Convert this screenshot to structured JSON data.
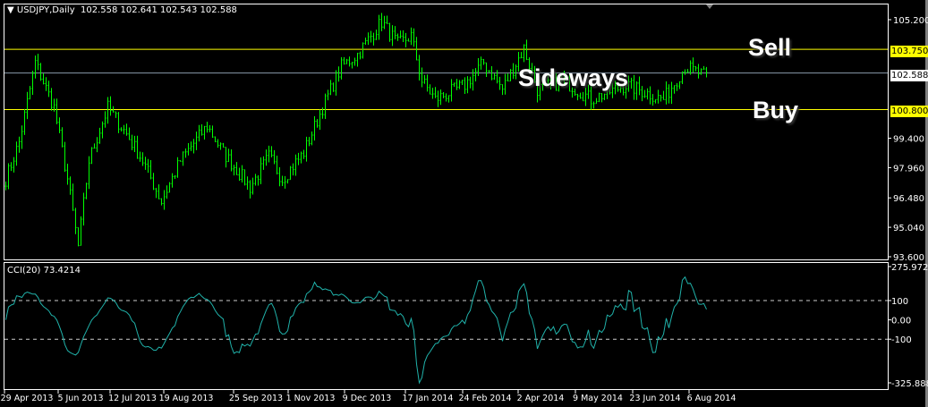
{
  "header": {
    "symbol": "USDJPY,Daily",
    "ohlc": "102.558 102.641 102.543 102.588"
  },
  "annotations": {
    "sell": "Sell",
    "sideways": "Sideways",
    "buy": "Buy"
  },
  "price_tags": {
    "sell_level": "103.750",
    "current": "102.588",
    "buy_level": "100.800"
  },
  "colors": {
    "bars": "#00ff00",
    "cci": "#20b2aa",
    "level": "#ffff00",
    "bid": "#8899aa"
  },
  "chart_data": [
    {
      "type": "ohlc",
      "title": "USDJPY,Daily",
      "yticks": [
        "105.200",
        "103.750",
        "102.588",
        "100.800",
        "99.400",
        "97.960",
        "96.480",
        "95.040",
        "93.600"
      ],
      "ylim": [
        93.6,
        105.2
      ],
      "hlines": [
        103.75,
        102.588,
        100.8
      ],
      "xticks": [
        "29 Apr 2013",
        "5 Jun 2013",
        "12 Jul 2013",
        "19 Aug 2013",
        "25 Sep 2013",
        "1 Nov 2013",
        "9 Dec 2013",
        "17 Jan 2014",
        "24 Feb 2014",
        "2 Apr 2014",
        "9 May 2014",
        "23 Jun 2014",
        "6 Aug 2014"
      ],
      "close_waypoints": [
        [
          0,
          97.4
        ],
        [
          5,
          99.2
        ],
        [
          11,
          103.1
        ],
        [
          18,
          100.9
        ],
        [
          23,
          97.4
        ],
        [
          27,
          94.1
        ],
        [
          31,
          98.3
        ],
        [
          38,
          100.9
        ],
        [
          45,
          99.6
        ],
        [
          51,
          98.3
        ],
        [
          58,
          96.3
        ],
        [
          65,
          98.3
        ],
        [
          75,
          100.0
        ],
        [
          81,
          98.7
        ],
        [
          91,
          97.0
        ],
        [
          98,
          98.5
        ],
        [
          103,
          97.4
        ],
        [
          111,
          98.7
        ],
        [
          118,
          100.9
        ],
        [
          125,
          102.9
        ],
        [
          131,
          103.5
        ],
        [
          140,
          105.1
        ],
        [
          146,
          104.0
        ],
        [
          151,
          104.4
        ],
        [
          155,
          102.2
        ],
        [
          160,
          101.3
        ],
        [
          171,
          102.0
        ],
        [
          178,
          103.1
        ],
        [
          185,
          101.8
        ],
        [
          193,
          103.8
        ],
        [
          198,
          101.8
        ],
        [
          208,
          102.2
        ],
        [
          218,
          101.3
        ],
        [
          231,
          102.0
        ],
        [
          245,
          101.3
        ],
        [
          253,
          102.9
        ],
        [
          261,
          102.4
        ]
      ]
    },
    {
      "type": "line",
      "title": "CCI(20) 73.4214",
      "period": 20,
      "yticks": [
        "275.9725",
        "100",
        "0.00",
        "-100",
        "-325.888"
      ],
      "ylim": [
        -325.888,
        275.9725
      ],
      "levels": [
        100,
        -100
      ]
    }
  ]
}
